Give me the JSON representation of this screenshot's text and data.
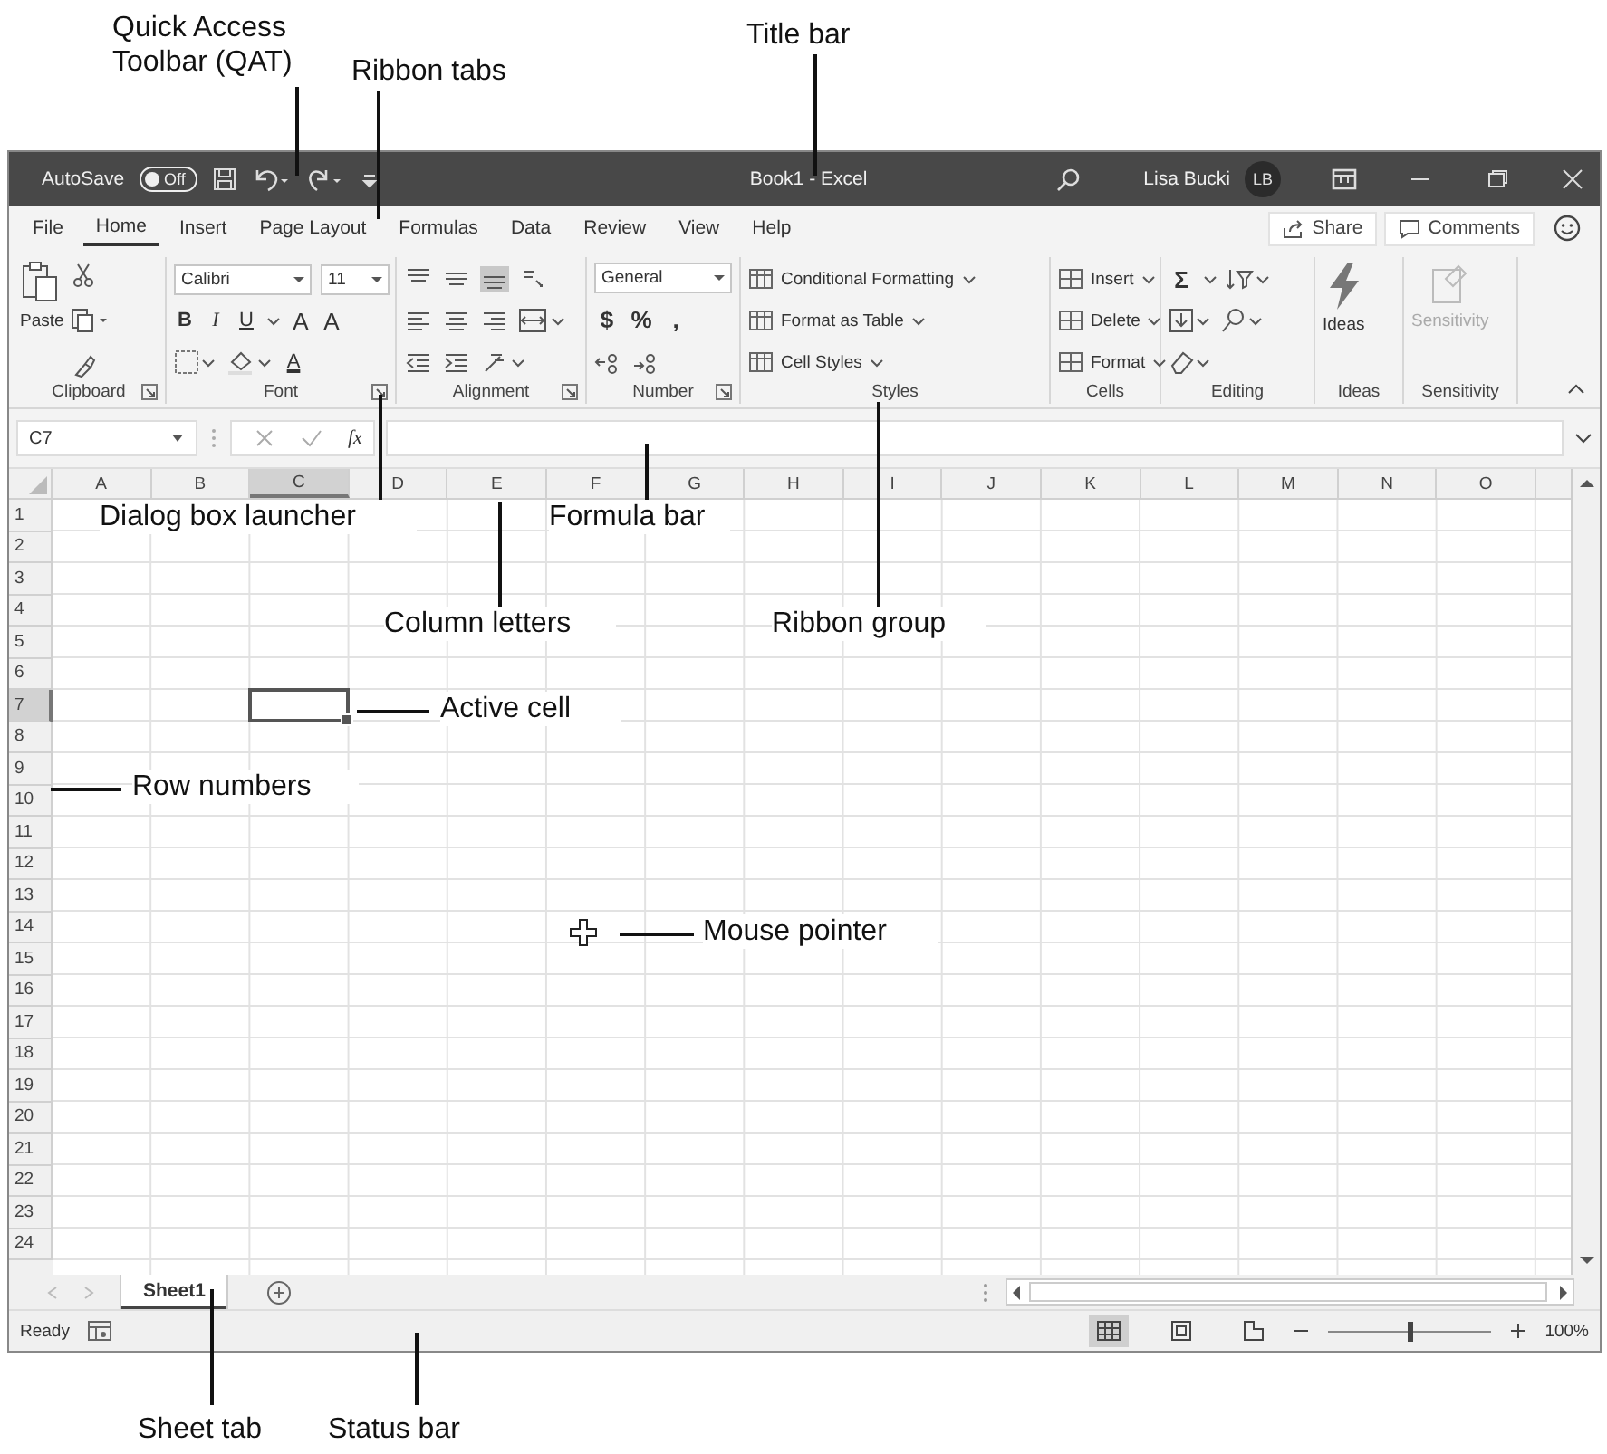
{
  "callouts": [
    "Quick Access Toolbar (QAT)",
    "Ribbon tabs",
    "Title bar",
    "Dialog box launcher",
    "Formula bar",
    "Column letters",
    "Ribbon group",
    "Active cell",
    "Row numbers",
    "Mouse pointer",
    "Sheet tab",
    "Status bar"
  ],
  "title_bar": {
    "autosave_label": "AutoSave",
    "autosave": {
      "label": "Off",
      "on": false
    },
    "document_title": "Book1 - Excel",
    "user_name": "Lisa Bucki",
    "user_initials": "LB"
  },
  "ribbon_tabs": [
    {
      "label": "File",
      "selected": false
    },
    {
      "label": "Home",
      "selected": true
    },
    {
      "label": "Insert",
      "selected": false
    },
    {
      "label": "Page Layout",
      "selected": false
    },
    {
      "label": "Formulas",
      "selected": false
    },
    {
      "label": "Data",
      "selected": false
    },
    {
      "label": "Review",
      "selected": false
    },
    {
      "label": "View",
      "selected": false
    },
    {
      "label": "Help",
      "selected": false
    }
  ],
  "share_button": "Share",
  "comments_button": "Comments",
  "ribbon_groups": [
    {
      "kind": "clipboard",
      "label": "Clipboard",
      "launcher": true,
      "paste": "Paste"
    },
    {
      "kind": "font",
      "label": "Font",
      "launcher": true,
      "font_name": "Calibri",
      "font_size": "11",
      "style_buttons": [
        "B",
        "I",
        "U"
      ],
      "size_buttons": [
        "A",
        "A"
      ],
      "font_color": "A"
    },
    {
      "kind": "alignment",
      "label": "Alignment",
      "launcher": true,
      "bottom_align_selected": true
    },
    {
      "kind": "number",
      "label": "Number",
      "launcher": true,
      "format": "General",
      "symbols": [
        "$",
        "%",
        ","
      ]
    },
    {
      "kind": "styles",
      "label": "Styles",
      "launcher": false,
      "commands": [
        "Conditional Formatting",
        "Format as Table",
        "Cell Styles"
      ]
    },
    {
      "kind": "cells",
      "label": "Cells",
      "launcher": false,
      "commands": [
        "Insert",
        "Delete",
        "Format"
      ]
    },
    {
      "kind": "editing",
      "label": "Editing",
      "launcher": false,
      "sum": "Σ"
    },
    {
      "kind": "ideas",
      "label": "Ideas",
      "launcher": false,
      "command": "Ideas"
    },
    {
      "kind": "sensitivity",
      "label": "Sensitivity",
      "launcher": false,
      "command": "Sensitivity",
      "disabled": true
    }
  ],
  "formula_bar": {
    "name_box": "C7",
    "function_label": "fx"
  },
  "columns": [
    {
      "label": "A",
      "selected": false
    },
    {
      "label": "B",
      "selected": false
    },
    {
      "label": "C",
      "selected": true
    },
    {
      "label": "D",
      "selected": false
    },
    {
      "label": "E",
      "selected": false
    },
    {
      "label": "F",
      "selected": false
    },
    {
      "label": "G",
      "selected": false
    },
    {
      "label": "H",
      "selected": false
    },
    {
      "label": "I",
      "selected": false
    },
    {
      "label": "J",
      "selected": false
    },
    {
      "label": "K",
      "selected": false
    },
    {
      "label": "L",
      "selected": false
    },
    {
      "label": "M",
      "selected": false
    },
    {
      "label": "N",
      "selected": false
    },
    {
      "label": "O",
      "selected": false
    }
  ],
  "rows": [
    {
      "label": "1",
      "selected": false
    },
    {
      "label": "2",
      "selected": false
    },
    {
      "label": "3",
      "selected": false
    },
    {
      "label": "4",
      "selected": false
    },
    {
      "label": "5",
      "selected": false
    },
    {
      "label": "6",
      "selected": false
    },
    {
      "label": "7",
      "selected": true
    },
    {
      "label": "8",
      "selected": false
    },
    {
      "label": "9",
      "selected": false
    },
    {
      "label": "10",
      "selected": false
    },
    {
      "label": "11",
      "selected": false
    },
    {
      "label": "12",
      "selected": false
    },
    {
      "label": "13",
      "selected": false
    },
    {
      "label": "14",
      "selected": false
    },
    {
      "label": "15",
      "selected": false
    },
    {
      "label": "16",
      "selected": false
    },
    {
      "label": "17",
      "selected": false
    },
    {
      "label": "18",
      "selected": false
    },
    {
      "label": "19",
      "selected": false
    },
    {
      "label": "20",
      "selected": false
    },
    {
      "label": "21",
      "selected": false
    },
    {
      "label": "22",
      "selected": false
    },
    {
      "label": "23",
      "selected": false
    },
    {
      "label": "24",
      "selected": false
    }
  ],
  "sheet_tabs": [
    {
      "label": "Sheet1",
      "selected": true
    }
  ],
  "status_bar": {
    "mode": "Ready",
    "views": [
      {
        "kind": "normal",
        "selected": true
      },
      {
        "kind": "page_layout",
        "selected": false
      },
      {
        "kind": "page_break",
        "selected": false
      }
    ],
    "zoom_slider": {
      "level": 0.5
    },
    "zoom": "100%"
  }
}
